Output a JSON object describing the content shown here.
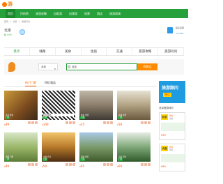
{
  "logo": {
    "text": "游网"
  },
  "greennav": {
    "items": [
      "首页",
      "目的地",
      "旅游攻略",
      "自助游",
      "出境游",
      "机票",
      "酒店",
      "旅游商城"
    ]
  },
  "breadcrumb": [
    "首页",
    ">",
    "北京",
    ">",
    "旅游景点"
  ],
  "location": {
    "city": "北京",
    "temp": "晴 17℃",
    "right_text": "联系客服",
    "right_num": "127361"
  },
  "category_tabs": [
    "景点",
    "线路",
    "美食",
    "住宿",
    "交通",
    "旅游攻略",
    "旅游问问"
  ],
  "search": {
    "select_value": "北京",
    "input_value": "北京",
    "button_label": "找景点"
  },
  "section_tabs": [
    {
      "label": "热门门票"
    },
    {
      "label": "特价酒店"
    }
  ],
  "cards_row1": [
    {
      "badge": "门票",
      "price": "49",
      "cur": "¥",
      "caption": "古寺 秋色"
    },
    {
      "badge": "门票",
      "price": "140",
      "cur": "¥",
      "caption": "扫码 购票"
    },
    {
      "badge": "门票",
      "price": "35",
      "cur": "¥",
      "caption": "峡谷 漂流"
    },
    {
      "badge": "门票",
      "price": "58",
      "cur": "¥",
      "caption": "古镇 夜景"
    }
  ],
  "cards_row2": [
    {
      "badge": "门票",
      "price": "49",
      "cur": "¥",
      "caption": "乐园 门票"
    },
    {
      "badge": "门票",
      "price": "50",
      "cur": "¥",
      "caption": "古刹 名寺"
    },
    {
      "badge": "门票",
      "price": "65",
      "cur": "¥",
      "caption": "园林 景区"
    },
    {
      "badge": "门票",
      "price": "60",
      "cur": "¥",
      "caption": "山谷 风光"
    }
  ],
  "sidebar": {
    "ad_title": "旅游顾问",
    "ad_sub": "预订",
    "title": "北京旅游特价",
    "blocks": [
      {
        "city": "北京",
        "label": "特价",
        "tag": "旅游",
        "price": "¥39"
      },
      {
        "city": "大连",
        "label": "特价",
        "tag": "旅游",
        "price": "¥69"
      }
    ]
  }
}
